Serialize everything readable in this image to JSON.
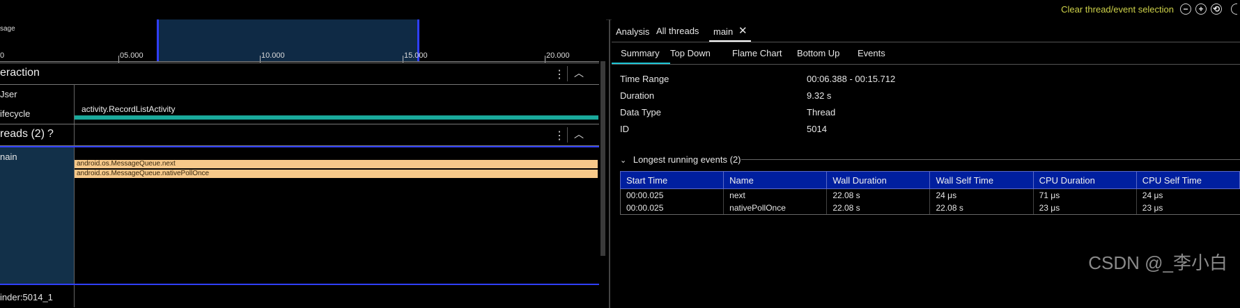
{
  "toolbar": {
    "clear_selection_label": "Clear thread/event selection",
    "zoom_out_icon": "minus-circle-icon",
    "zoom_in_icon": "plus-circle-icon",
    "reset_zoom_icon": "reset-circle-icon"
  },
  "timeline": {
    "ruler_label": "sage",
    "ticks": [
      "0",
      "05.000",
      "10.000",
      "15.000",
      "20.000"
    ],
    "interaction": {
      "title": "eraction",
      "rows": [
        {
          "label": "Jser"
        },
        {
          "label": "ifecycle",
          "event": "activity.RecordListActivity"
        }
      ]
    },
    "threads": {
      "title": "reads (2)",
      "help": "?",
      "main_label": "nain",
      "bars": [
        "android.os.MessageQueue.next",
        "android.os.MessageQueue.nativePollOnce"
      ],
      "binder_label": "inder:5014_1"
    }
  },
  "analysis": {
    "top_tabs": [
      {
        "label": "Analysis"
      },
      {
        "label": "All threads"
      },
      {
        "label": "main",
        "closable": true
      }
    ],
    "sub_tabs": [
      "Summary",
      "Top Down",
      "Flame Chart",
      "Bottom Up",
      "Events"
    ],
    "summary": [
      {
        "key": "Time Range",
        "value": "00:06.388 - 00:15.712"
      },
      {
        "key": "Duration",
        "value": "9.32 s"
      },
      {
        "key": "Data Type",
        "value": "Thread"
      },
      {
        "key": "ID",
        "value": "5014"
      }
    ],
    "longest_events_title": "Longest running events (2)",
    "columns": [
      "Start Time",
      "Name",
      "Wall Duration",
      "Wall Self Time",
      "CPU Duration",
      "CPU Self Time"
    ],
    "rows": [
      [
        "00:00.025",
        "next",
        "22.08 s",
        "24 μs",
        "71 μs",
        "24 μs"
      ],
      [
        "00:00.025",
        "nativePollOnce",
        "22.08 s",
        "22.08 s",
        "23 μs",
        "23 μs"
      ]
    ]
  },
  "watermark": "CSDN @_李小白",
  "colors": {
    "accent_yellow": "#cfd34a",
    "selection_blue": "#2f3fff",
    "lifecycle_teal": "#1aa99b",
    "trace_bar": "#f7c98a",
    "table_header": "#001f9f",
    "tab_underline": "#1cc6d6"
  }
}
